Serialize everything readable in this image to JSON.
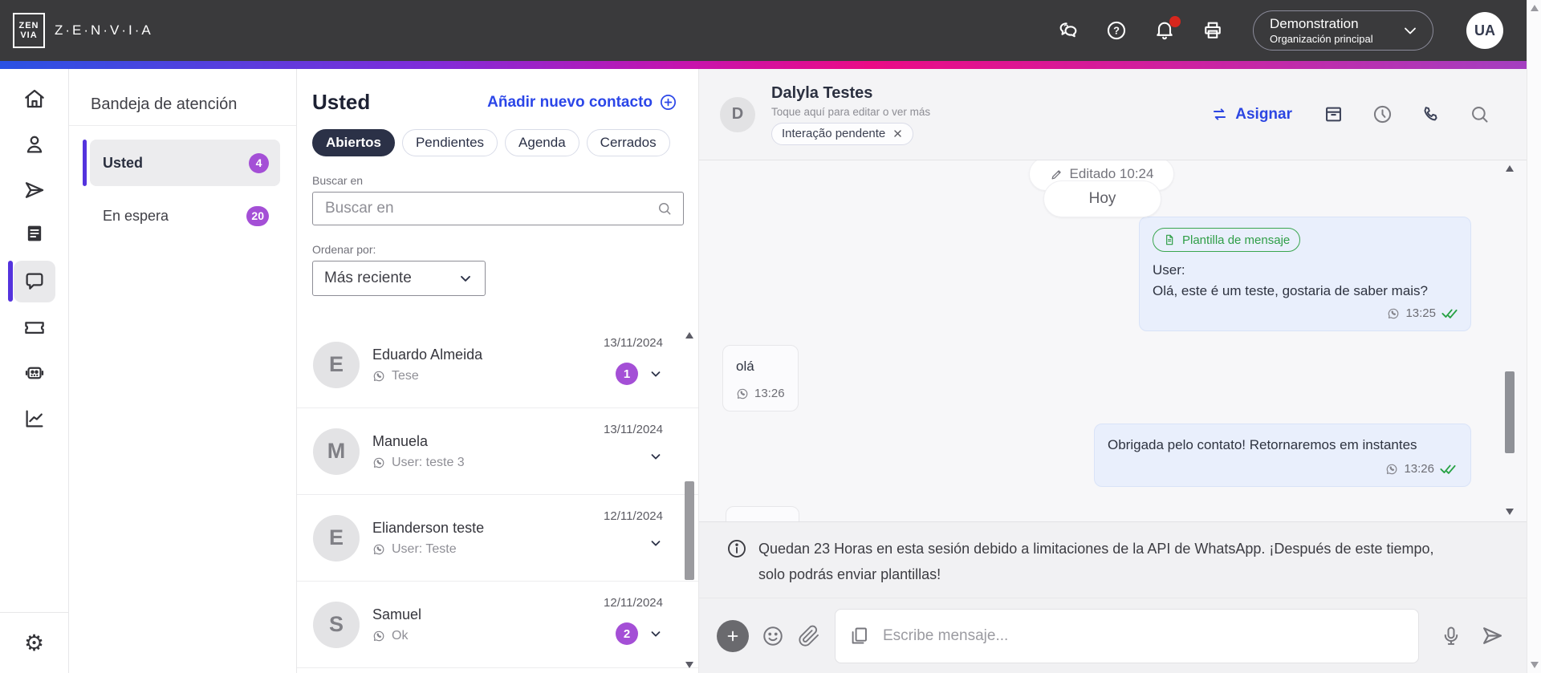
{
  "colors": {
    "header_bg": "#3a3a3c",
    "accent_badge_purple": "#a44fd6",
    "active_bar_purple": "#5433dd",
    "link_blue": "#2b46e8",
    "template_green": "#2f9e47",
    "notification_red": "#d7261d",
    "gradient": [
      "#2a52e3",
      "#7f2cd9",
      "#ea0b86",
      "#a43fc0"
    ]
  },
  "header": {
    "logo_top": "ZEN",
    "logo_bottom": "VIA",
    "brand": "Z·E·N·V·I·A",
    "icons": [
      "chat-help-icon",
      "help-icon",
      "notifications-icon",
      "print-icon"
    ],
    "notification_dot": true,
    "org_name": "Demonstration",
    "org_subtitle": "Organización principal",
    "avatar_initials": "UA"
  },
  "nav": {
    "items": [
      "home",
      "contacts",
      "send",
      "news",
      "chat",
      "tickets",
      "bot",
      "reports"
    ],
    "active": "chat",
    "bottom": "settings"
  },
  "inbox": {
    "title": "Bandeja de atención",
    "items": [
      {
        "label": "Usted",
        "count": "4",
        "active": true
      },
      {
        "label": "En espera",
        "count": "20",
        "active": false
      }
    ]
  },
  "list": {
    "title": "Usted",
    "add_contact_label": "Añadir nuevo contacto",
    "tabs": [
      {
        "label": "Abiertos",
        "active": true
      },
      {
        "label": "Pendientes",
        "active": false
      },
      {
        "label": "Agenda",
        "active": false
      },
      {
        "label": "Cerrados",
        "active": false
      }
    ],
    "search_label": "Buscar en",
    "search_placeholder": "Buscar en",
    "sort_label": "Ordenar por:",
    "sort_value": "Más reciente",
    "contacts": [
      {
        "initial": "E",
        "name": "Eduardo Almeida",
        "channel": "whatsapp",
        "last_message": "Tese",
        "date": "13/11/2024",
        "unread": "1"
      },
      {
        "initial": "M",
        "name": "Manuela",
        "channel": "whatsapp",
        "last_message": "User: teste 3",
        "date": "13/11/2024",
        "unread": ""
      },
      {
        "initial": "E",
        "name": "Elianderson teste",
        "channel": "whatsapp",
        "last_message": "User: Teste",
        "date": "12/11/2024",
        "unread": ""
      },
      {
        "initial": "S",
        "name": "Samuel",
        "channel": "whatsapp",
        "last_message": "Ok",
        "date": "12/11/2024",
        "unread": "2"
      }
    ]
  },
  "chat": {
    "contact": {
      "initial": "D",
      "name": "Dalyla Testes",
      "subtitle": "Toque aquí para editar o ver más",
      "tag": "Interação pendente"
    },
    "assign_label": "Asignar",
    "edited_label": "Editado 10:24",
    "day_label": "Hoy",
    "messages": [
      {
        "direction": "outgoing",
        "template_tag": "Plantilla de mensaje",
        "line1": "User:",
        "line2": "Olá, este é um teste, gostaria de saber mais?",
        "time": "13:25",
        "channel": "whatsapp",
        "status": "read"
      },
      {
        "direction": "incoming",
        "text": "olá",
        "time": "13:26",
        "channel": "whatsapp"
      },
      {
        "direction": "outgoing",
        "text": "Obrigada pelo contato! Retornaremos em instantes",
        "time": "13:26",
        "channel": "whatsapp",
        "status": "read"
      }
    ],
    "session_warning": {
      "line1": "Quedan 23 Horas en esta sesión debido a limitaciones de la API de WhatsApp. ¡Después de este tiempo,",
      "line2": "solo podrás enviar plantillas!"
    },
    "composer_placeholder": "Escribe mensaje..."
  }
}
